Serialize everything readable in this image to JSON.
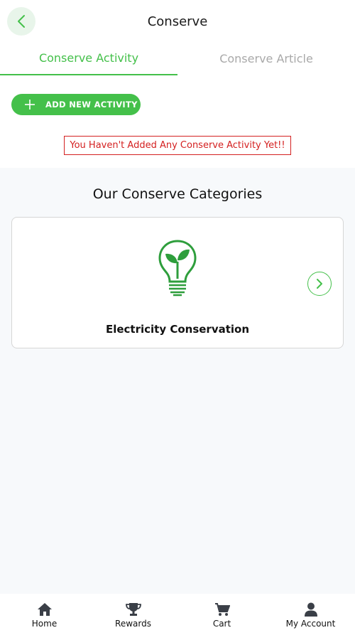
{
  "header": {
    "title": "Conserve",
    "back_icon": "chevron-left-icon"
  },
  "tabs": [
    {
      "label": "Conserve Activity",
      "active": true
    },
    {
      "label": "Conserve Article",
      "active": false
    }
  ],
  "activity": {
    "add_button_label": "ADD NEW ACTIVITY",
    "empty_message": "You Haven't Added Any Conserve Activity Yet!!"
  },
  "categories": {
    "title": "Our Conserve Categories",
    "items": [
      {
        "label": "Electricity Conservation",
        "icon": "lightbulb-leaf-icon"
      }
    ]
  },
  "bottom_nav": [
    {
      "label": "Home",
      "icon": "home-icon"
    },
    {
      "label": "Rewards",
      "icon": "trophy-icon"
    },
    {
      "label": "Cart",
      "icon": "cart-icon"
    },
    {
      "label": "My Account",
      "icon": "user-icon"
    }
  ],
  "colors": {
    "accent": "#44c04a",
    "error": "#d42020",
    "background": "#f7f9fb"
  }
}
